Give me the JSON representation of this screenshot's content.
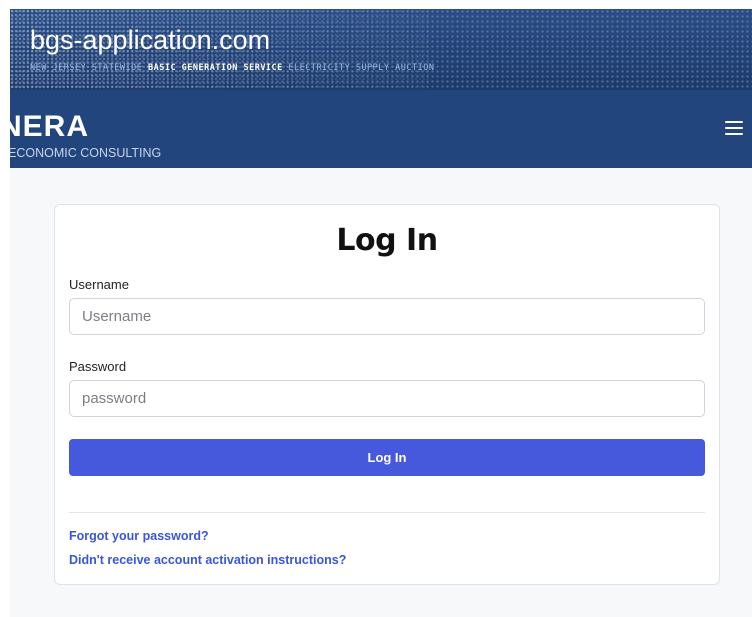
{
  "header": {
    "site_title": "bgs-application.com",
    "tagline_part1": "NEW JERSEY STATEWIDE ",
    "tagline_highlight": "BASIC GENERATION SERVICE",
    "tagline_part2": " ELECTRICITY SUPPLY AUCTION",
    "brand_logo": "NERA",
    "brand_subtitle": "ECONOMIC CONSULTING",
    "menu_icon": "hamburger-menu-icon"
  },
  "login": {
    "title": "Log In",
    "username_label": "Username",
    "username_placeholder": "Username",
    "username_value": "",
    "password_label": "Password",
    "password_placeholder": "password",
    "password_value": "",
    "submit_label": "Log In",
    "forgot_password_link": "Forgot your password?",
    "activation_link": "Didn't receive account activation instructions?"
  },
  "colors": {
    "header_bg": "#23457d",
    "accent_button": "#4658dc",
    "link": "#3b55d9"
  }
}
